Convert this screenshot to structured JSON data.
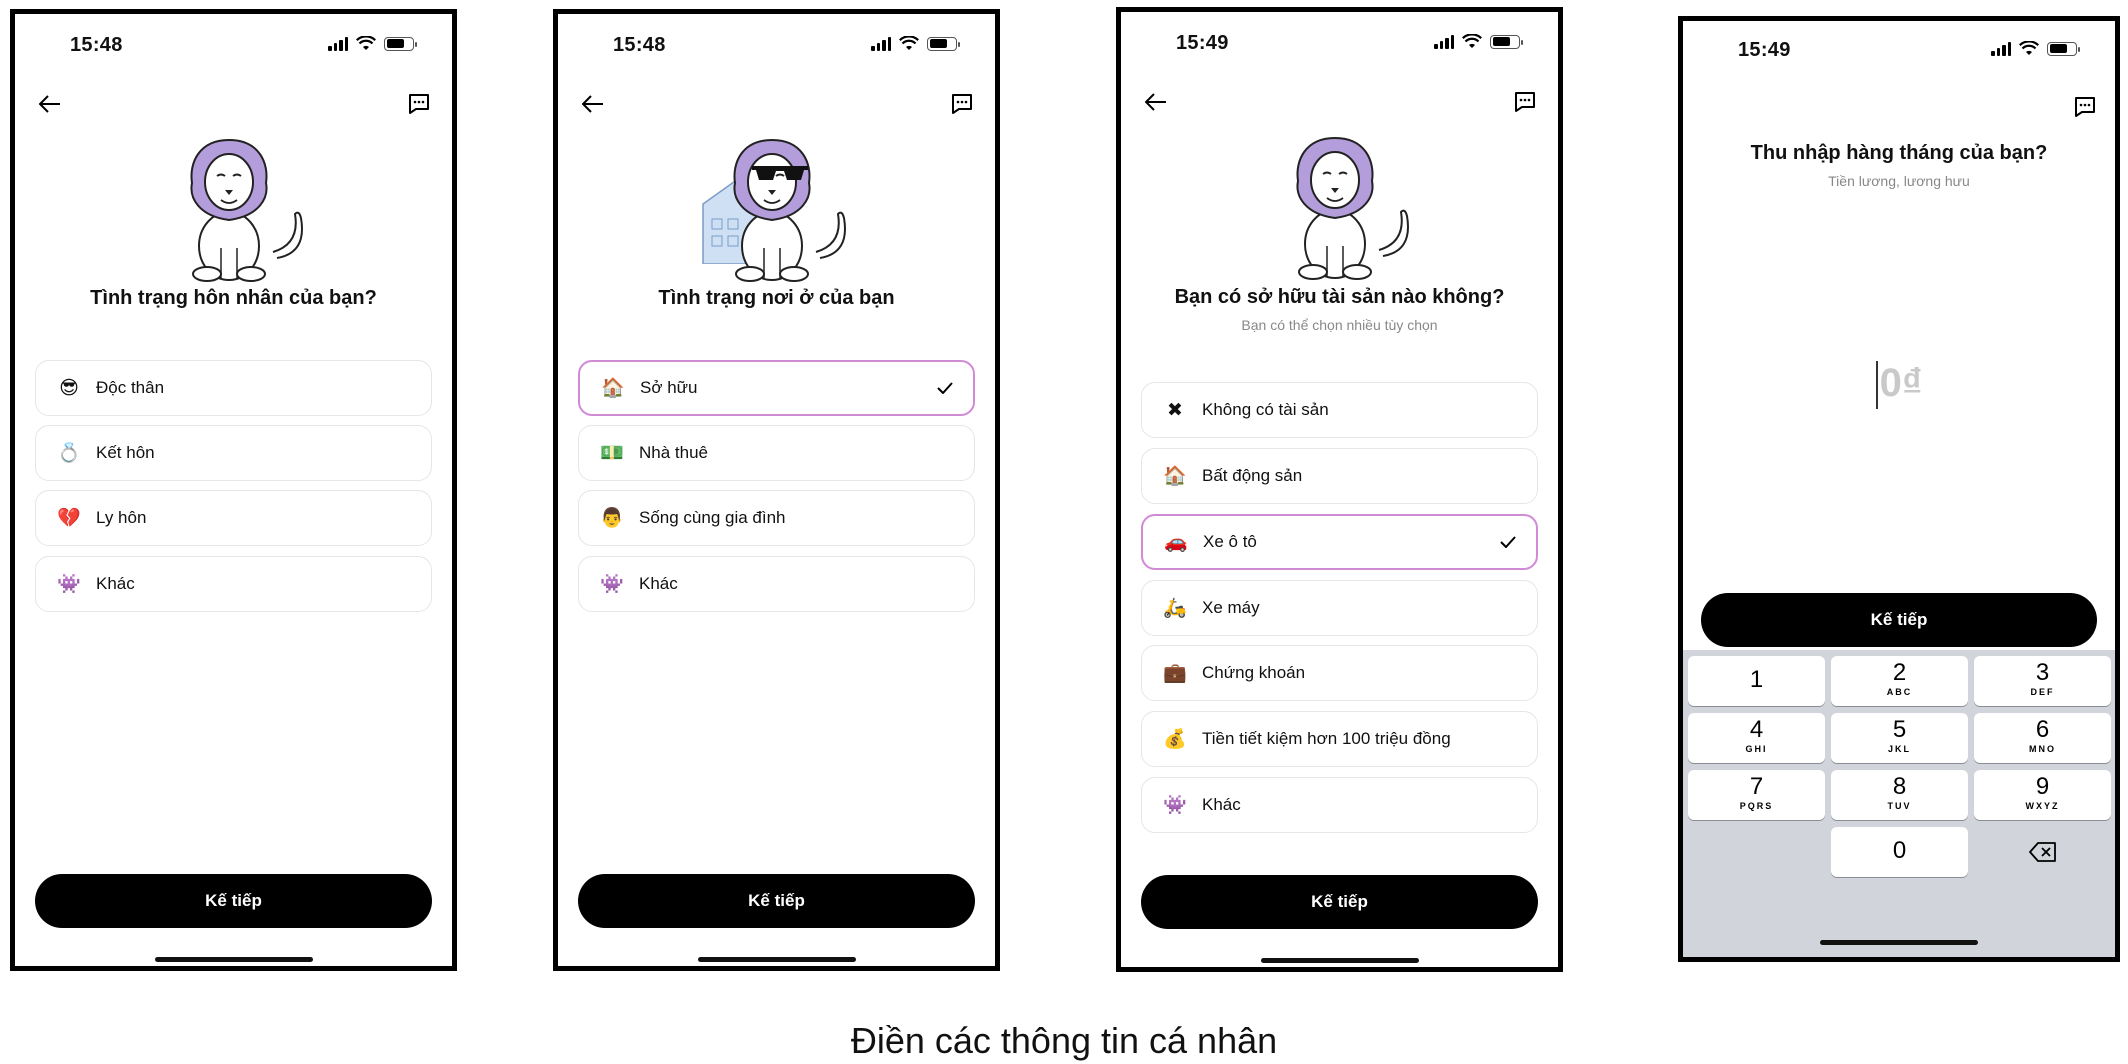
{
  "screens": [
    {
      "time": "15:48",
      "question": "Tình trạng hôn nhân của bạn?",
      "options": [
        {
          "emoji": "😎",
          "label": "Độc thân"
        },
        {
          "emoji": "💍",
          "label": "Kết hôn"
        },
        {
          "emoji": "💔",
          "label": "Ly hôn"
        },
        {
          "emoji": "👾",
          "label": "Khác"
        }
      ],
      "next_label": "Kế tiếp"
    },
    {
      "time": "15:48",
      "question": "Tình trạng nơi ở của bạn",
      "options": [
        {
          "emoji": "🏠",
          "label": "Sở hữu",
          "selected": true
        },
        {
          "emoji": "💵",
          "label": "Nhà thuê"
        },
        {
          "emoji": "👨",
          "label": "Sống cùng gia đình"
        },
        {
          "emoji": "👾",
          "label": "Khác"
        }
      ],
      "next_label": "Kế tiếp"
    },
    {
      "time": "15:49",
      "question": "Bạn có sở hữu tài sản nào không?",
      "subtitle": "Bạn có thể chọn nhiều tùy chọn",
      "options": [
        {
          "emoji": "✖",
          "label": "Không có tài sản"
        },
        {
          "emoji": "🏠",
          "label": "Bất động sản"
        },
        {
          "emoji": "🚗",
          "label": "Xe ô tô",
          "selected": true
        },
        {
          "emoji": "🛵",
          "label": "Xe máy"
        },
        {
          "emoji": "💼",
          "label": "Chứng khoán"
        },
        {
          "emoji": "💰",
          "label": "Tiền tiết kiệm hơn 100 triệu đồng"
        },
        {
          "emoji": "👾",
          "label": "Khác"
        }
      ],
      "next_label": "Kế tiếp"
    },
    {
      "time": "15:49",
      "question": "Thu nhập hàng tháng của bạn?",
      "subtitle": "Tiền lương, lương hưu",
      "amount_placeholder": "0₫",
      "next_label": "Kế tiếp",
      "keypad": [
        {
          "n": "1",
          "l": ""
        },
        {
          "n": "2",
          "l": "ABC"
        },
        {
          "n": "3",
          "l": "DEF"
        },
        {
          "n": "4",
          "l": "GHI"
        },
        {
          "n": "5",
          "l": "JKL"
        },
        {
          "n": "6",
          "l": "MNO"
        },
        {
          "n": "7",
          "l": "PQRS"
        },
        {
          "n": "8",
          "l": "TUV"
        },
        {
          "n": "9",
          "l": "WXYZ"
        },
        {
          "n": "0",
          "l": ""
        }
      ]
    }
  ],
  "caption": "Điền các thông tin cá nhân",
  "colors": {
    "selected_border": "#d18ad6",
    "button": "#000000",
    "keypad_bg": "#d1d4db",
    "lion_mane": "#b39ddb"
  }
}
